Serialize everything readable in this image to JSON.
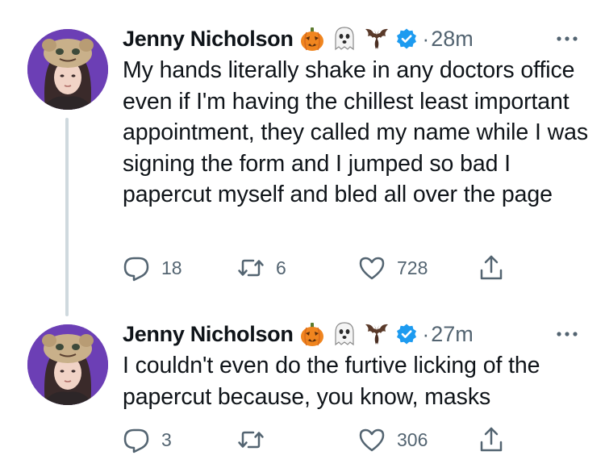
{
  "tweets": [
    {
      "author": {
        "display_name": "Jenny Nicholson",
        "emoji": [
          "jack-o-lantern",
          "ghost",
          "bat"
        ],
        "verified": true
      },
      "dot": "·",
      "timestamp": "28m",
      "text": "My hands literally shake in any doctors office even if I'm having the chillest least important appointment, they called my name while I was signing the form and I jumped so bad I papercut myself and bled all over the page",
      "replies": "18",
      "retweets": "6",
      "likes": "728"
    },
    {
      "author": {
        "display_name": "Jenny Nicholson",
        "emoji": [
          "jack-o-lantern",
          "ghost",
          "bat"
        ],
        "verified": true
      },
      "dot": "·",
      "timestamp": "27m",
      "text": "I couldn't even do the furtive licking of the papercut because, you know, masks",
      "replies": "3",
      "retweets": "",
      "likes": "306"
    }
  ],
  "colors": {
    "text": "#0f1419",
    "secondary": "#536471",
    "verified": "#1d9bf0",
    "thread_line": "#cfd9de",
    "avatar_bg": "#6c3fb5"
  }
}
